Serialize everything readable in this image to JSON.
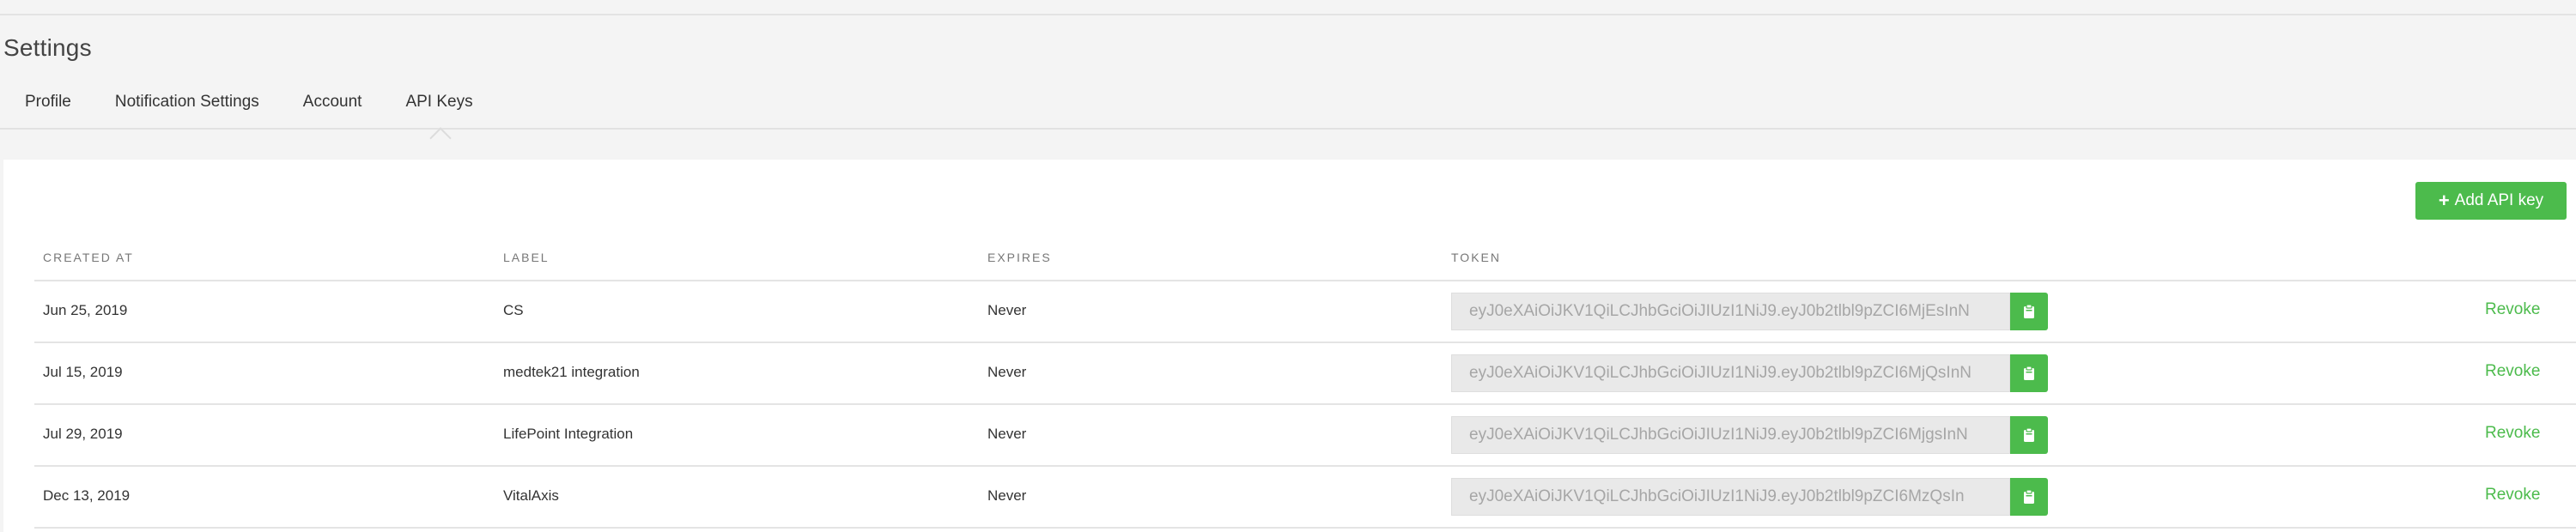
{
  "page": {
    "title": "Settings"
  },
  "tabs": [
    {
      "label": "Profile",
      "active": false
    },
    {
      "label": "Notification Settings",
      "active": false
    },
    {
      "label": "Account",
      "active": false
    },
    {
      "label": "API Keys",
      "active": true
    }
  ],
  "actions": {
    "add_label": "Add API key",
    "add_icon": "plus-icon"
  },
  "columns": [
    "CREATED AT",
    "LABEL",
    "EXPIRES",
    "TOKEN"
  ],
  "rows": [
    {
      "created": "Jun 25, 2019",
      "label": "CS",
      "expires": "Never",
      "token": "eyJ0eXAiOiJKV1QiLCJhbGciOiJIUzI1NiJ9.eyJ0b2tlbl9pZCI6MjEsInN",
      "revoke": "Revoke"
    },
    {
      "created": "Jul 15, 2019",
      "label": "medtek21 integration",
      "expires": "Never",
      "token": "eyJ0eXAiOiJKV1QiLCJhbGciOiJIUzI1NiJ9.eyJ0b2tlbl9pZCI6MjQsInN",
      "revoke": "Revoke"
    },
    {
      "created": "Jul 29, 2019",
      "label": "LifePoint Integration",
      "expires": "Never",
      "token": "eyJ0eXAiOiJKV1QiLCJhbGciOiJIUzI1NiJ9.eyJ0b2tlbl9pZCI6MjgsInN",
      "revoke": "Revoke"
    },
    {
      "created": "Dec 13, 2019",
      "label": "VitalAxis",
      "expires": "Never",
      "token": "eyJ0eXAiOiJKV1QiLCJhbGciOiJIUzI1NiJ9.eyJ0b2tlbl9pZCI6MzQsIn",
      "revoke": "Revoke"
    }
  ],
  "colors": {
    "accent": "#4cbb4c",
    "background": "#f4f4f4",
    "card": "#ffffff",
    "token_field": "#e9e9e9"
  },
  "icons": {
    "copy": "clipboard-icon"
  }
}
